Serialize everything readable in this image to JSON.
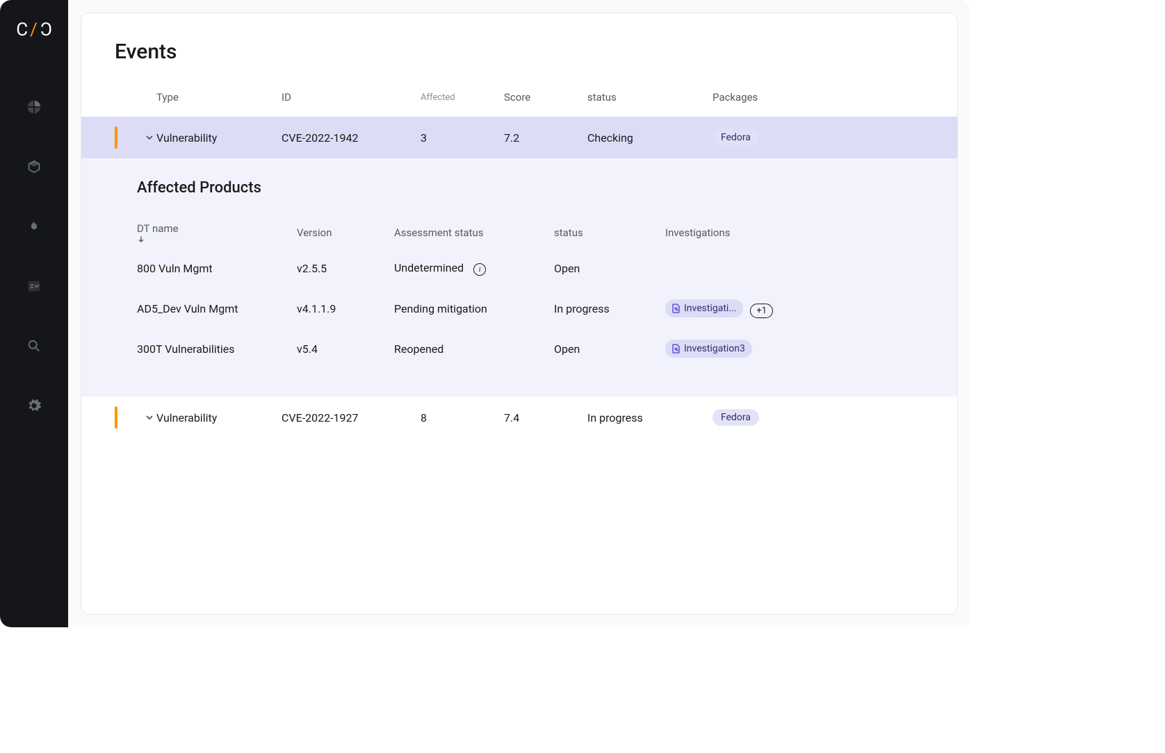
{
  "page": {
    "title": "Events"
  },
  "events": {
    "headers": {
      "type": "Type",
      "id": "ID",
      "affected": "Affected",
      "score": "Score",
      "status": "status",
      "packages": "Packages"
    },
    "rows": [
      {
        "type": "Vulnerability",
        "id": "CVE-2022-1942",
        "affected": "3",
        "score": "7.2",
        "status": "Checking",
        "package": "Fedora",
        "expanded": true
      },
      {
        "type": "Vulnerability",
        "id": "CVE-2022-1927",
        "affected": "8",
        "score": "7.4",
        "status": "In progress",
        "package": "Fedora",
        "expanded": false
      }
    ]
  },
  "detail": {
    "title": "Affected Products",
    "headers": {
      "dtname": "DT name",
      "version": "Version",
      "assessment": "Assessment status",
      "status": "status",
      "investigations": "Investigations"
    },
    "rows": [
      {
        "dtname": "800 Vuln Mgmt",
        "version": "v2.5.5",
        "assessment": "Undetermined",
        "info": true,
        "status": "Open",
        "investigation": "",
        "extra": ""
      },
      {
        "dtname": "AD5_Dev Vuln Mgmt",
        "version": "v4.1.1.9",
        "assessment": "Pending mitigation",
        "info": false,
        "status": "In progress",
        "investigation": "Investigati...",
        "extra": "+1"
      },
      {
        "dtname": "300T Vulnerabilities",
        "version": "v5.4",
        "assessment": "Reopened",
        "info": false,
        "status": "Open",
        "investigation": "Investigation3",
        "extra": ""
      }
    ]
  }
}
